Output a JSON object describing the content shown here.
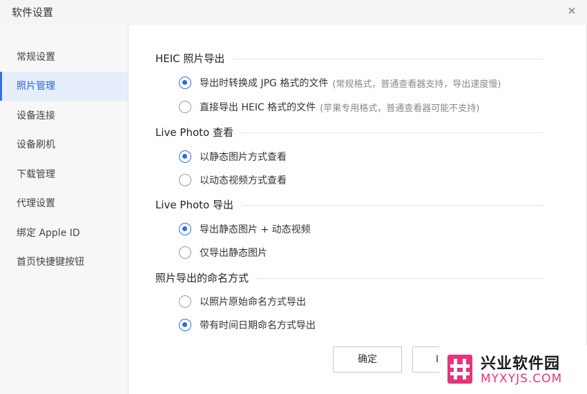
{
  "window": {
    "title": "软件设置"
  },
  "sidebar": {
    "items": [
      {
        "label": "常规设置",
        "active": false
      },
      {
        "label": "照片管理",
        "active": true
      },
      {
        "label": "设备连接",
        "active": false
      },
      {
        "label": "设备刷机",
        "active": false
      },
      {
        "label": "下载管理",
        "active": false
      },
      {
        "label": "代理设置",
        "active": false
      },
      {
        "label": "绑定 Apple ID",
        "active": false
      },
      {
        "label": "首页快捷键按钮",
        "active": false
      }
    ]
  },
  "sections": [
    {
      "title": "HEIC 照片导出",
      "options": [
        {
          "label": "导出时转换成 JPG 格式的文件",
          "hint": "(常规格式，普通查看器支持，导出速度慢)",
          "checked": true
        },
        {
          "label": "直接导出 HEIC 格式的文件",
          "hint": "(苹果专用格式，普通查看器可能不支持)",
          "checked": false
        }
      ]
    },
    {
      "title": "Live Photo 查看",
      "options": [
        {
          "label": "以静态图片方式查看",
          "checked": true
        },
        {
          "label": "以动态视频方式查看",
          "checked": false
        }
      ]
    },
    {
      "title": "Live Photo 导出",
      "options": [
        {
          "label": "导出静态图片 + 动态视频",
          "checked": true
        },
        {
          "label": "仅导出静态图片",
          "checked": false
        }
      ]
    },
    {
      "title": "照片导出的命名方式",
      "options": [
        {
          "label": "以照片原始命名方式导出",
          "checked": false
        },
        {
          "label": "带有时间日期命名方式导出",
          "checked": true
        }
      ]
    }
  ],
  "buttons": {
    "ok": "确定",
    "cancel_partial": "I"
  },
  "watermark": {
    "name": "兴业软件园",
    "domain": "MYXYJS.COM",
    "accent_color": "#e5357a"
  },
  "colors": {
    "accent": "#2f6ce0",
    "sidebar_active_bg": "#e6eefc"
  }
}
